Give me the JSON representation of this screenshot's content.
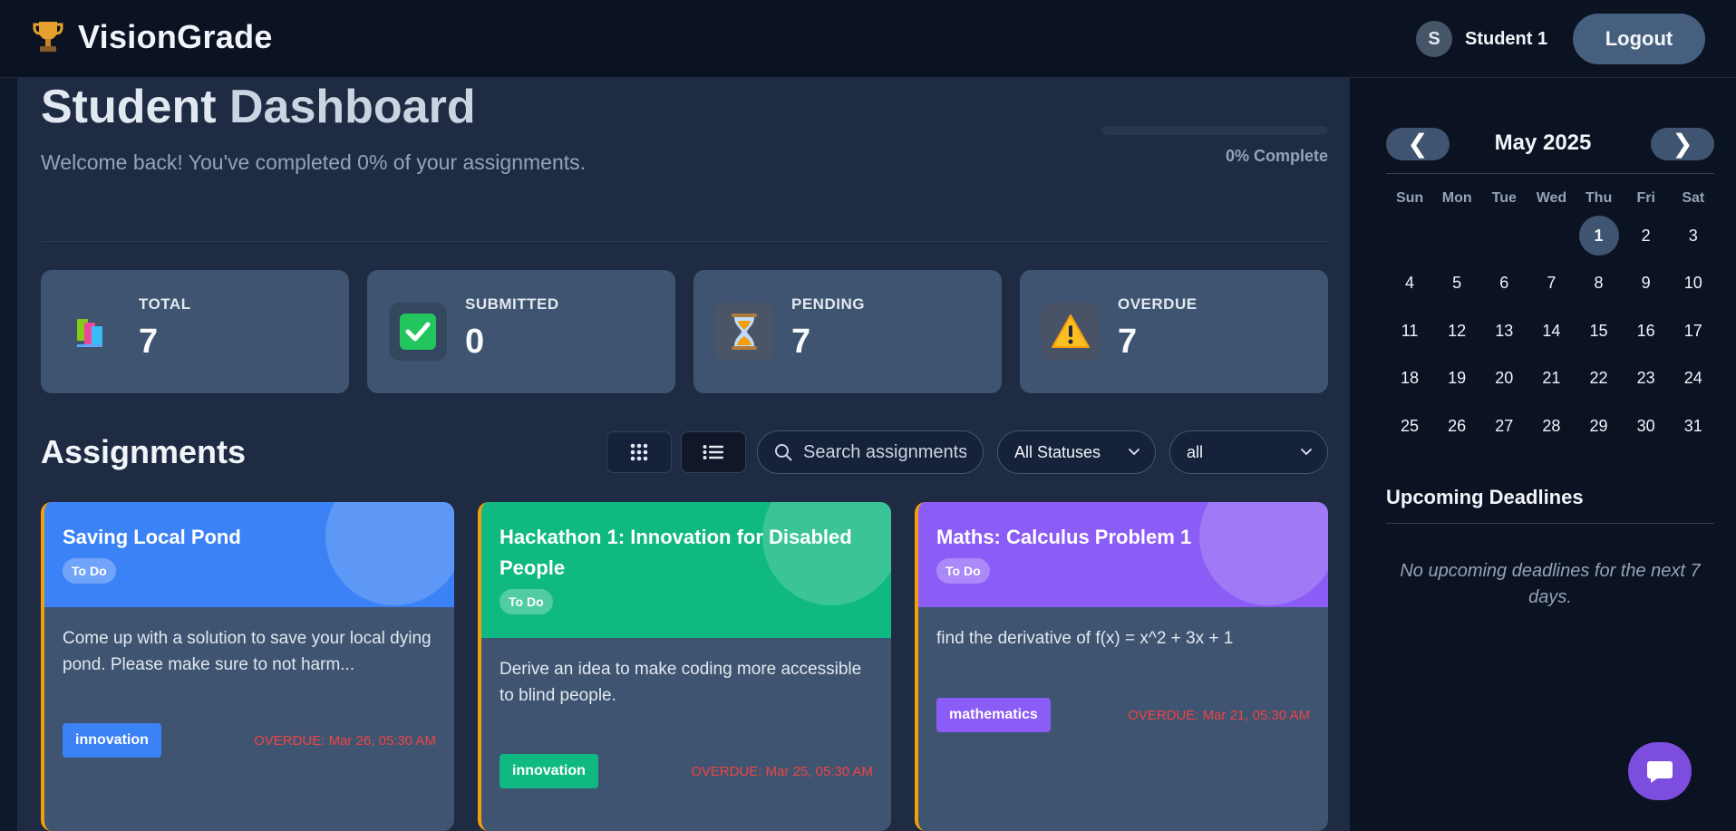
{
  "header": {
    "brand": "VisionGrade",
    "user_initial": "S",
    "user_name": "Student 1",
    "logout_label": "Logout"
  },
  "dashboard": {
    "title_part1": "Student",
    "title_part2": "Dashboard",
    "welcome": "Welcome back! You've completed 0% of your assignments.",
    "progress_percent": 0,
    "progress_label": "0% Complete"
  },
  "stats": [
    {
      "label": "TOTAL",
      "value": "7",
      "icon": "books-icon"
    },
    {
      "label": "SUBMITTED",
      "value": "0",
      "icon": "checkmark-icon"
    },
    {
      "label": "PENDING",
      "value": "7",
      "icon": "hourglass-icon"
    },
    {
      "label": "OVERDUE",
      "value": "7",
      "icon": "warning-icon"
    }
  ],
  "assignments": {
    "title": "Assignments",
    "search_placeholder": "Search assignments...",
    "status_filter": "All Statuses",
    "category_filter": "all",
    "cards": [
      {
        "title": "Saving Local Pond",
        "status": "To Do",
        "description": "Come up with a solution to save your local dying pond. Please make sure to not harm...",
        "tag": "innovation",
        "due": "OVERDUE: Mar 26, 05:30 AM",
        "color": "#3b82f6"
      },
      {
        "title": "Hackathon 1: Innovation for Disabled People",
        "status": "To Do",
        "description": "Derive an idea to make coding more accessible to blind people.",
        "tag": "innovation",
        "due": "OVERDUE: Mar 25, 05:30 AM",
        "color": "#10b981"
      },
      {
        "title": "Maths: Calculus Problem 1",
        "status": "To Do",
        "description": "find the derivative of f(x) = x^2 + 3x + 1",
        "tag": "mathematics",
        "due": "OVERDUE: Mar 21, 05:30 AM",
        "color": "#8b5cf6"
      }
    ]
  },
  "calendar": {
    "prev_label": "❮",
    "next_label": "❯",
    "month": "May 2025",
    "weekdays": [
      "Sun",
      "Mon",
      "Tue",
      "Wed",
      "Thu",
      "Fri",
      "Sat"
    ],
    "first_weekday_index": 4,
    "days_in_month": 31,
    "today": 1
  },
  "upcoming": {
    "title": "Upcoming Deadlines",
    "empty_message": "No upcoming deadlines for the next 7 days."
  },
  "colors": {
    "accent_blue": "#3b82f6",
    "accent_green": "#10b981",
    "accent_purple": "#8b5cf6",
    "overdue_red": "#ef4444",
    "card_border": "#f59e0b"
  }
}
